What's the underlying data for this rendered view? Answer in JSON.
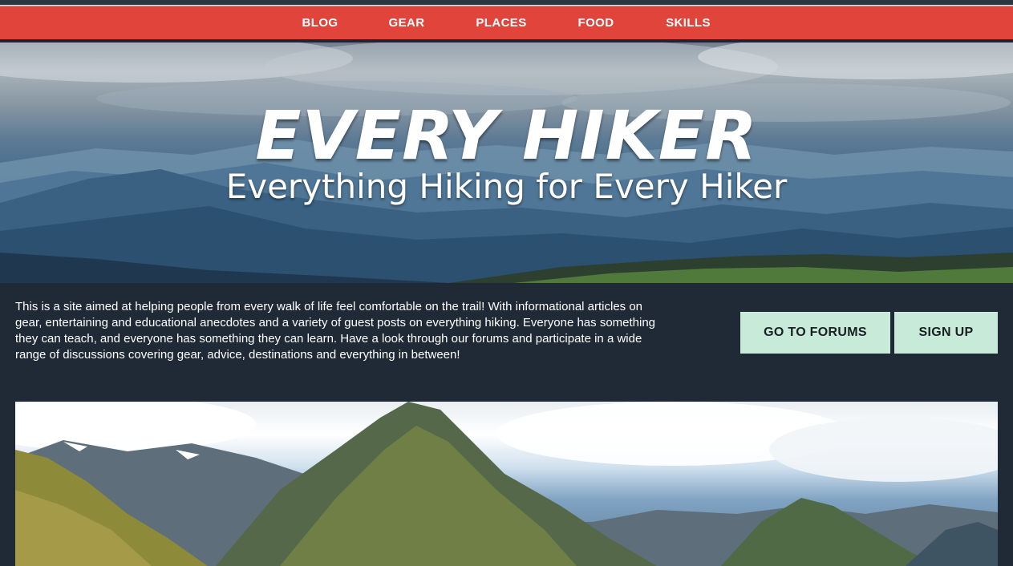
{
  "nav": {
    "items": [
      {
        "label": "BLOG"
      },
      {
        "label": "GEAR"
      },
      {
        "label": "PLACES"
      },
      {
        "label": "FOOD"
      },
      {
        "label": "SKILLS"
      }
    ]
  },
  "hero": {
    "title": "EVERY HIKER",
    "subtitle": "Everything Hiking for Every Hiker"
  },
  "intro": {
    "text": "This is a site aimed at helping people from every walk of life feel comfortable on the trail! With informational articles on gear, entertaining and educational anecdotes and a variety of guest posts on everything hiking. Everyone has something they can teach, and everyone has something they can learn. Have a look through our forums and participate in a wide range of discussions covering gear, advice, destinations and everything in between!"
  },
  "actions": {
    "forums_label": "GO TO FORUMS",
    "signup_label": "SIGN UP"
  },
  "colors": {
    "nav_bg": "#e0443a",
    "page_bg": "#1f2a36",
    "button_bg": "#c8ead9",
    "text": "#ffffff"
  }
}
